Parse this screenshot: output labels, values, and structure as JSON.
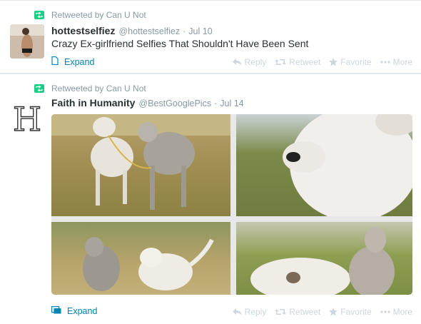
{
  "tweets": [
    {
      "retweeted_by": "Retweeted by Can U Not",
      "name": "hottestselfiez",
      "handle": "@hottestselfiez",
      "separator": "·",
      "date": "Jul 10",
      "text": "Crazy Ex-girlfriend Selfies That Shouldn't Have Been Sent",
      "expand_label": "Expand"
    },
    {
      "retweeted_by": "Retweeted by Can U Not",
      "name": "Faith in Humanity",
      "handle": "@BestGooglePics",
      "separator": "·",
      "date": "Jul 14",
      "avatar_letter": "H",
      "expand_label": "Expand"
    }
  ],
  "actions": {
    "reply": "Reply",
    "retweet": "Retweet",
    "favorite": "Favorite",
    "more": "More"
  },
  "colors": {
    "link": "#0084b4",
    "retweet_green": "#19cf86",
    "muted": "#8899a6",
    "action": "#ccd6dd"
  }
}
